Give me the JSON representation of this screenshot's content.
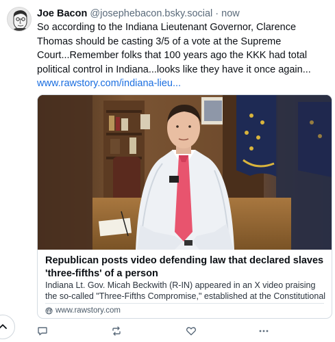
{
  "post": {
    "author_name": "Joe Bacon",
    "author_handle": "@josephebacon.bsky.social",
    "separator": "·",
    "timestamp": "now",
    "text": "So according to the Indiana Lieutenant Governor, Clarence Thomas should be casting 3/5 of a vote at the Supreme Court...Remember folks that 100 years ago the KKK had total political control in Indiana...looks like they have it once again...",
    "link_text": "www.rawstory.com/indiana-lieu..."
  },
  "link_card": {
    "title": "Republican posts video defending law that declared slaves 'three-fifths' of a person",
    "description": "Indiana Lt. Gov. Micah Beckwith (R-IN) appeared in an X video praising the so-called \"Three-Fifths Compromise,\" established at the Constitutional ...",
    "domain": "www.rawstory.com",
    "image_icon": "video-thumbnail"
  },
  "actions": {
    "reply_icon": "reply-icon",
    "repost_icon": "repost-icon",
    "like_icon": "heart-icon",
    "more_icon": "more-icon"
  },
  "colors": {
    "link": "#1a6ee0",
    "muted": "#5a6a7a",
    "border": "#d4dbe2"
  }
}
